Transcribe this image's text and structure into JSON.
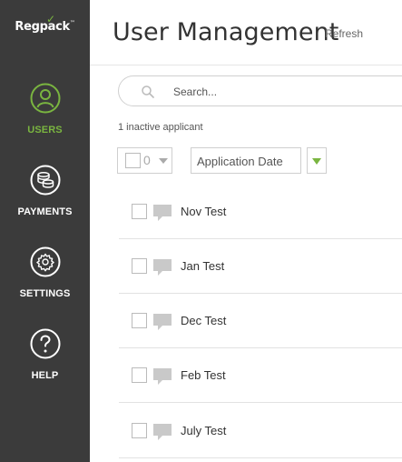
{
  "sidebar": {
    "logo": {
      "text": "Regpack",
      "trademark": "™"
    },
    "items": [
      {
        "key": "users",
        "label": "USERS",
        "icon": "user-icon",
        "active": true
      },
      {
        "key": "payments",
        "label": "PAYMENTS",
        "icon": "coins-icon",
        "active": false
      },
      {
        "key": "settings",
        "label": "SETTINGS",
        "icon": "gear-icon",
        "active": false
      },
      {
        "key": "help",
        "label": "HELP",
        "icon": "question-icon",
        "active": false
      }
    ]
  },
  "header": {
    "title": "User Management",
    "refresh_label": "Refresh"
  },
  "search": {
    "placeholder": "Search...",
    "value": ""
  },
  "status": {
    "text": "1 inactive applicant"
  },
  "controls": {
    "selected_count": "0",
    "sort_label": "Application Date"
  },
  "users": [
    {
      "name": "Nov Test"
    },
    {
      "name": "Jan Test"
    },
    {
      "name": "Dec Test"
    },
    {
      "name": "Feb Test"
    },
    {
      "name": "July Test"
    }
  ],
  "colors": {
    "sidebar_bg": "#3b3b3b",
    "accent": "#7ab540",
    "text": "#333333"
  }
}
